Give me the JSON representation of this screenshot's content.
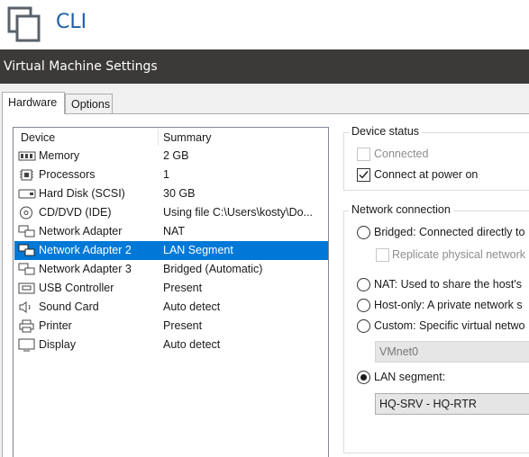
{
  "app": {
    "title": "CLI"
  },
  "window": {
    "title": "Virtual Machine Settings"
  },
  "tabs": [
    {
      "label": "Hardware",
      "active": true
    },
    {
      "label": "Options",
      "active": false
    }
  ],
  "device_list": {
    "headers": {
      "device": "Device",
      "summary": "Summary"
    },
    "rows": [
      {
        "icon": "memory-icon",
        "name": "Memory",
        "summary": "2 GB",
        "selected": false
      },
      {
        "icon": "processor-icon",
        "name": "Processors",
        "summary": "1",
        "selected": false
      },
      {
        "icon": "hard-disk-icon",
        "name": "Hard Disk (SCSI)",
        "summary": "30 GB",
        "selected": false
      },
      {
        "icon": "cd-dvd-icon",
        "name": "CD/DVD (IDE)",
        "summary": "Using file C:\\Users\\kosty\\Do...",
        "selected": false
      },
      {
        "icon": "network-adapter-icon",
        "name": "Network Adapter",
        "summary": "NAT",
        "selected": false
      },
      {
        "icon": "network-adapter-icon",
        "name": "Network Adapter 2",
        "summary": "LAN Segment",
        "selected": true
      },
      {
        "icon": "network-adapter-icon",
        "name": "Network Adapter 3",
        "summary": "Bridged (Automatic)",
        "selected": false
      },
      {
        "icon": "usb-icon",
        "name": "USB Controller",
        "summary": "Present",
        "selected": false
      },
      {
        "icon": "sound-card-icon",
        "name": "Sound Card",
        "summary": "Auto detect",
        "selected": false
      },
      {
        "icon": "printer-icon",
        "name": "Printer",
        "summary": "Present",
        "selected": false
      },
      {
        "icon": "display-icon",
        "name": "Display",
        "summary": "Auto detect",
        "selected": false
      }
    ]
  },
  "device_status": {
    "title": "Device status",
    "connected_label": "Connected",
    "connected_checked": false,
    "power_on_label": "Connect at power on",
    "power_on_checked": true
  },
  "network_connection": {
    "title": "Network connection",
    "bridged_label": "Bridged: Connected directly to",
    "replicate_label": "Replicate physical network",
    "nat_label": "NAT: Used to share the host's",
    "hostonly_label": "Host-only: A private network s",
    "custom_label": "Custom: Specific virtual netwo",
    "custom_value": "VMnet0",
    "lan_label": "LAN segment:",
    "lan_value": "HQ-SRV - HQ-RTR",
    "selected_option": "lan"
  },
  "colors": {
    "accent": "#1f5fa8",
    "selection": "#0078d7",
    "titlebar": "#3b3a39"
  }
}
